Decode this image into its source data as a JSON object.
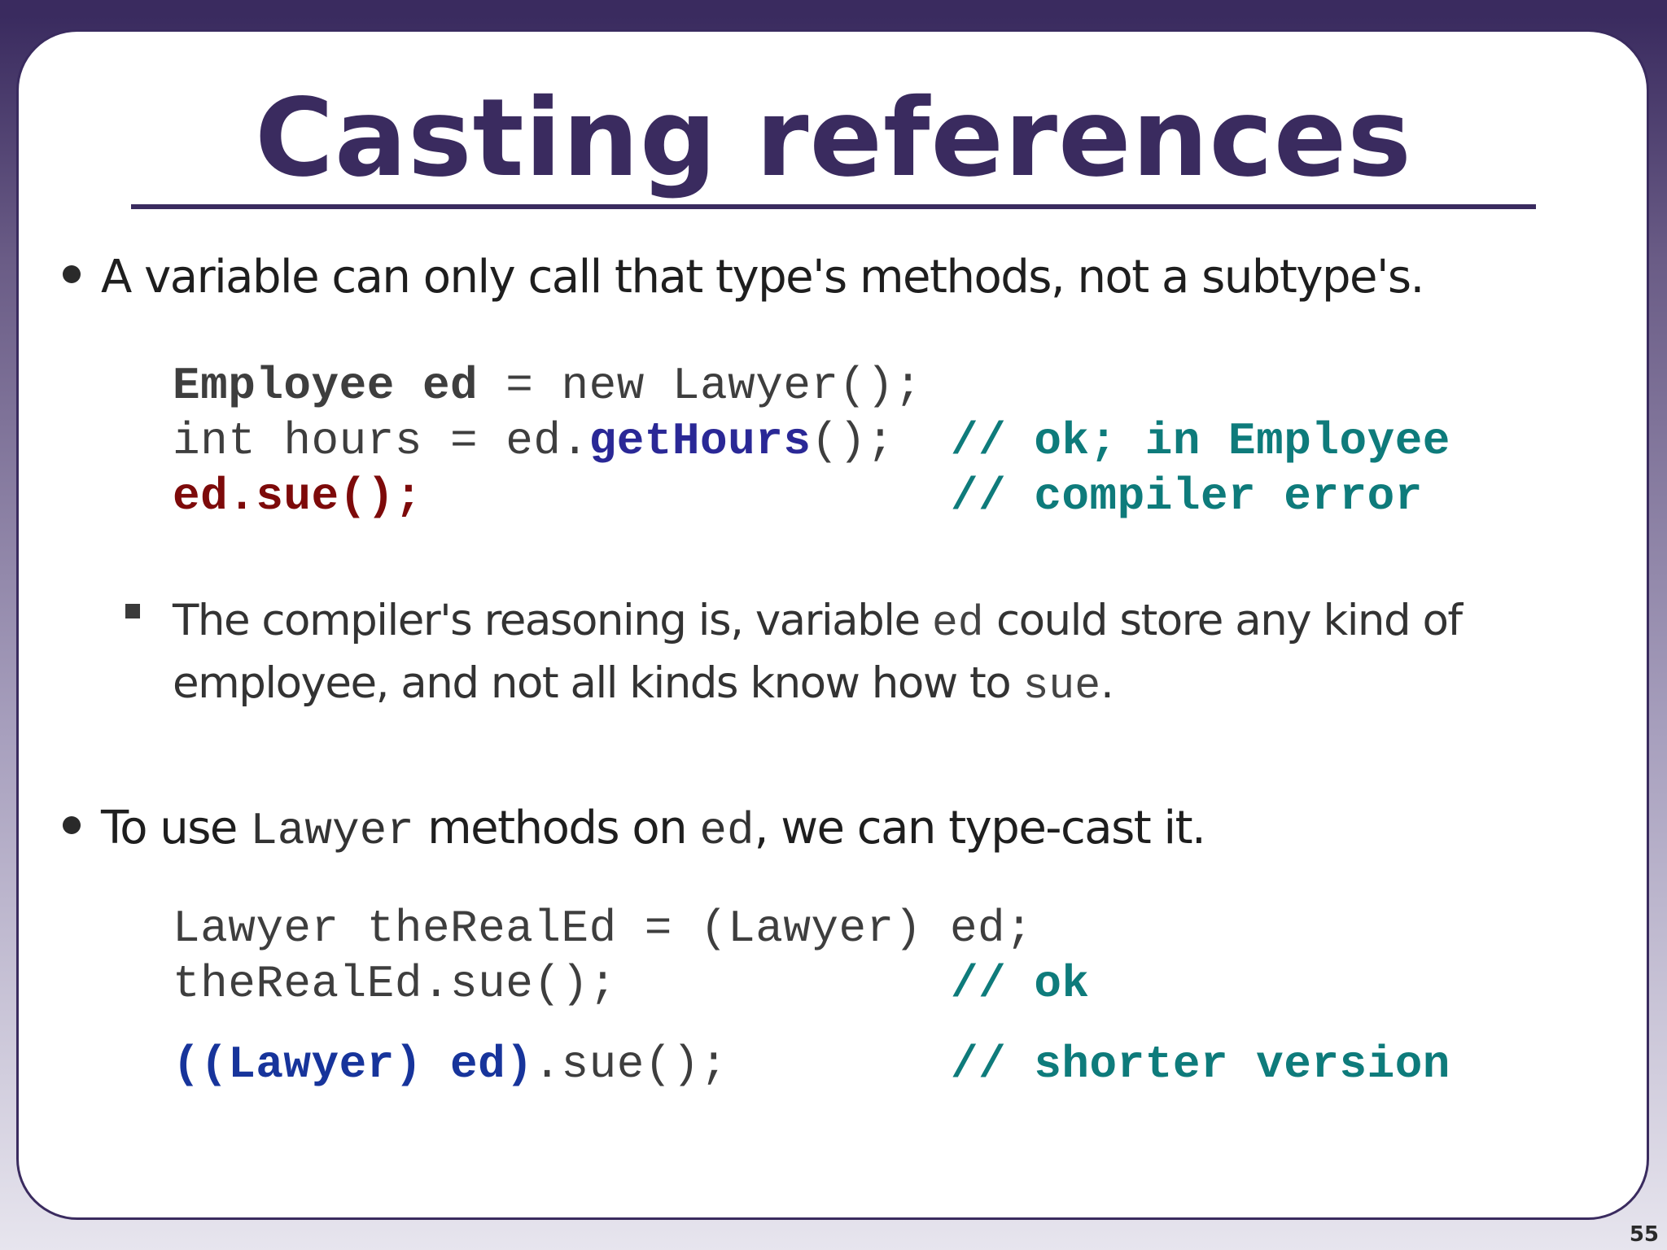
{
  "slide": {
    "title": "Casting references",
    "page_number": "55"
  },
  "bullet1": {
    "text": "A variable can only call that type's methods, not a subtype's."
  },
  "code1": {
    "line1": {
      "type": "Employee",
      "var": "ed",
      "rest": " = new Lawyer();"
    },
    "line2": {
      "lead": "int hours = ed.",
      "method": "getHours",
      "tail": "();",
      "comment": "// ok; in Employee"
    },
    "line3": {
      "error_code": "ed.sue();",
      "comment": "// compiler error"
    }
  },
  "sub_bullet": {
    "part1": "The compiler's reasoning is, variable ",
    "code1": "ed",
    "part2": " could store any kind of",
    "line2_part1": "employee, and not all kinds know how to ",
    "code2": "sue",
    "line2_part2": "."
  },
  "bullet2": {
    "part1": "To use ",
    "code1": "Lawyer",
    "part2": " methods on ",
    "code2": "ed",
    "part3": ", we can type-cast it."
  },
  "code2": {
    "line1": "Lawyer theRealEd = (Lawyer) ed;",
    "line2": {
      "code": "theRealEd.sue();",
      "comment": "// ok"
    },
    "line3": {
      "cast": "((Lawyer) ed)",
      "call": ".sue();",
      "comment": "// shorter version"
    }
  }
}
